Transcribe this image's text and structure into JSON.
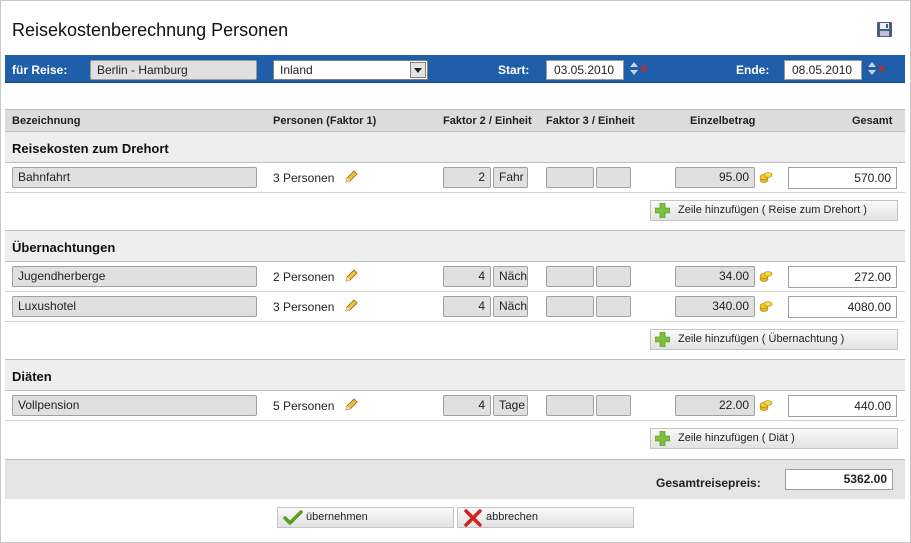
{
  "header": {
    "title": "Reisekostenberechnung Personen"
  },
  "trip": {
    "label": "für Reise:",
    "value": "Berlin - Hamburg",
    "type_selected": "Inland",
    "start_label": "Start:",
    "start_date": "03.05.2010",
    "end_label": "Ende:",
    "end_date": "08.05.2010"
  },
  "columns": {
    "bezeichnung": "Bezeichnung",
    "personen": "Personen (Faktor 1)",
    "faktor2": "Faktor 2 / Einheit",
    "faktor3": "Faktor 3 / Einheit",
    "einzelbetrag": "Einzelbetrag",
    "gesamt": "Gesamt"
  },
  "sections": [
    {
      "title": "Reisekosten zum Drehort",
      "rows": [
        {
          "name": "Bahnfahrt",
          "personen": "3 Personen",
          "faktor2": "2",
          "einheit2": "Fahr",
          "einzelbetrag": "95.00",
          "gesamt": "570.00"
        }
      ],
      "add_label": "Zeile  hinzufügen  ( Reise  zum  Drehort )"
    },
    {
      "title": "Übernachtungen",
      "rows": [
        {
          "name": "Jugendherberge",
          "personen": "2 Personen",
          "faktor2": "4",
          "einheit2": "Näch",
          "einzelbetrag": "34.00",
          "gesamt": "272.00"
        },
        {
          "name": "Luxushotel",
          "personen": "3 Personen",
          "faktor2": "4",
          "einheit2": "Näch",
          "einzelbetrag": "340.00",
          "gesamt": "4080.00"
        }
      ],
      "add_label": "Zeile  hinzufügen  ( Übernachtung )"
    },
    {
      "title": "Diäten",
      "rows": [
        {
          "name": "Vollpension",
          "personen": "5 Personen",
          "faktor2": "4",
          "einheit2": "Tage",
          "einzelbetrag": "22.00",
          "gesamt": "440.00"
        }
      ],
      "add_label": "Zeile  hinzufügen  ( Diät )"
    }
  ],
  "total": {
    "label": "Gesamtreisepreis:",
    "value": "5362.00"
  },
  "buttons": {
    "accept": "übernehmen",
    "cancel": "abbrechen"
  },
  "colors": {
    "header_bar": "#1f5ea8",
    "accept_check": "#5aa020",
    "cancel_x": "#d42020",
    "add_plus": "#7cc040"
  }
}
